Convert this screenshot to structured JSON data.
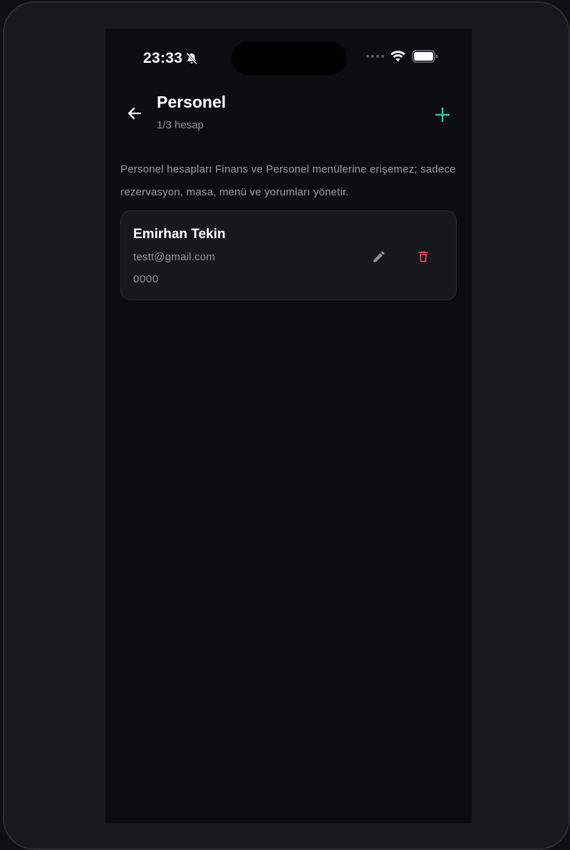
{
  "status_bar": {
    "time": "23:33",
    "silent_icon": "bell-slash-icon",
    "wifi_icon": "wifi-icon",
    "battery_icon": "battery-icon"
  },
  "header": {
    "title": "Personel",
    "subtitle": "1/3 hesap",
    "back_icon": "arrow-left-icon",
    "add_icon": "plus-icon"
  },
  "description": "Personel hesapları Finans ve Personel menülerine erişemez; sadece rezervasyon, masa, menü ve yorumları yönetir.",
  "staff": [
    {
      "name": "Emirhan Tekin",
      "email": "testt@gmail.com",
      "pin": "0000",
      "edit_icon": "pencil-icon",
      "delete_icon": "trash-icon"
    }
  ],
  "colors": {
    "background": "#0b0d10",
    "card": "#16181c",
    "accent": "#2ec4a4",
    "danger": "#e5484d",
    "text_primary": "#ffffff",
    "text_secondary": "#8f949a"
  }
}
